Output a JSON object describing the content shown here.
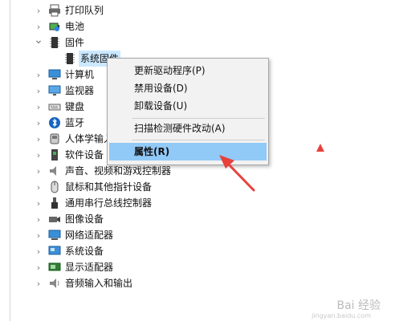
{
  "tree": {
    "items": [
      {
        "label": "打印队列",
        "icon": "printer-icon",
        "expanded": false
      },
      {
        "label": "电池",
        "icon": "battery-icon",
        "expanded": false
      },
      {
        "label": "固件",
        "icon": "firmware-icon",
        "expanded": true
      },
      {
        "label": "系统固件",
        "icon": "firmware-chip-icon",
        "child": true,
        "selected": true
      },
      {
        "label": "计算机",
        "icon": "computer-icon",
        "expanded": false
      },
      {
        "label": "监视器",
        "icon": "monitor-icon",
        "expanded": false
      },
      {
        "label": "键盘",
        "icon": "keyboard-icon",
        "expanded": false
      },
      {
        "label": "蓝牙",
        "icon": "bluetooth-icon",
        "expanded": false
      },
      {
        "label": "人体学输入设备",
        "icon": "hid-icon",
        "expanded": false
      },
      {
        "label": "软件设备",
        "icon": "software-device-icon",
        "expanded": false
      },
      {
        "label": "声音、视频和游戏控制器",
        "icon": "speaker-icon",
        "expanded": false
      },
      {
        "label": "鼠标和其他指针设备",
        "icon": "mouse-icon",
        "expanded": false
      },
      {
        "label": "通用串行总线控制器",
        "icon": "usb-icon",
        "expanded": false
      },
      {
        "label": "图像设备",
        "icon": "camera-icon",
        "expanded": false
      },
      {
        "label": "网络适配器",
        "icon": "network-icon",
        "expanded": false
      },
      {
        "label": "系统设备",
        "icon": "system-device-icon",
        "expanded": false
      },
      {
        "label": "显示适配器",
        "icon": "display-adapter-icon",
        "expanded": false
      },
      {
        "label": "音频输入和输出",
        "icon": "audio-io-icon",
        "expanded": false
      }
    ]
  },
  "context_menu": {
    "items": [
      {
        "label": "更新驱动程序(P)"
      },
      {
        "label": "禁用设备(D)"
      },
      {
        "label": "卸载设备(U)"
      },
      {
        "label": "扫描检测硬件改动(A)"
      },
      {
        "label": "属性(R)",
        "highlighted": true
      }
    ]
  },
  "watermark": {
    "text": "Bai 经验",
    "sub": "jingyan.baidu.com"
  },
  "colors": {
    "menu_highlight": "#91c9f7",
    "selection": "#cce8ff",
    "arrow": "#e8413c"
  }
}
